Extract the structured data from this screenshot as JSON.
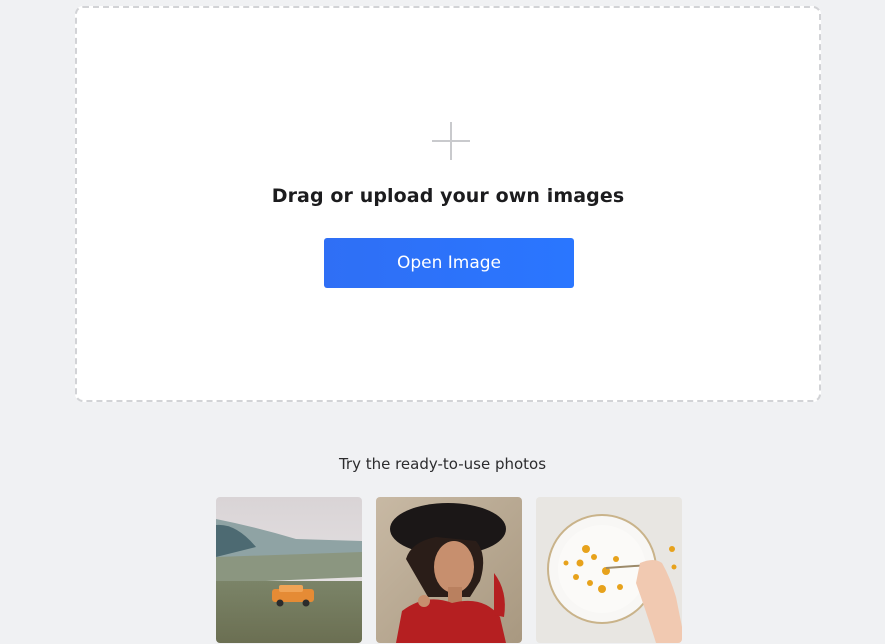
{
  "upload": {
    "title": "Drag or upload your own images",
    "button_label": "Open Image"
  },
  "samples": {
    "title": "Try the ready-to-use photos",
    "photos": [
      {
        "subject": "orange SUV in desert landscape"
      },
      {
        "subject": "woman in black hat and red outfit"
      },
      {
        "subject": "white plate with yellow flowers"
      }
    ]
  },
  "colors": {
    "background": "#f0f1f3",
    "accent": "#2a72fa",
    "dropzone_border": "#d2d3d6"
  }
}
